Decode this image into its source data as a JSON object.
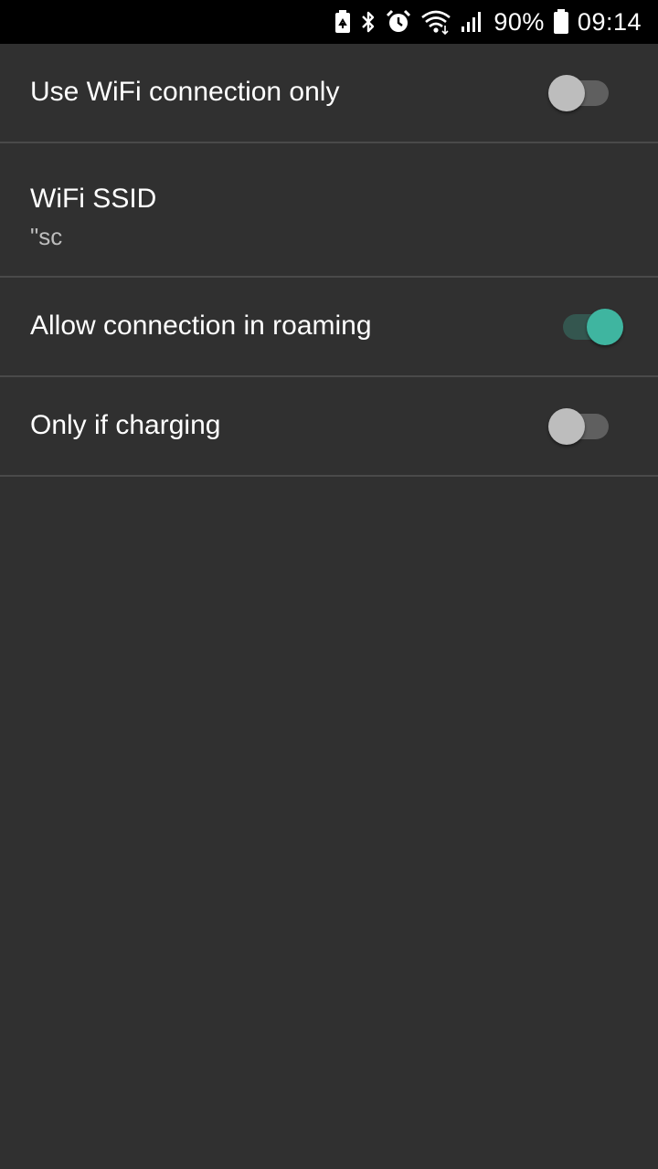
{
  "status_bar": {
    "battery_percent": "90%",
    "time": "09:14",
    "icons": [
      "battery-saver-icon",
      "bluetooth-icon",
      "alarm-icon",
      "wifi-icon",
      "signal-icon",
      "battery-icon"
    ]
  },
  "settings": [
    {
      "title": "Use WiFi connection only",
      "toggle": false
    },
    {
      "title": "WiFi SSID",
      "summary": "\"sc"
    },
    {
      "title": "Allow connection in roaming",
      "toggle": true
    },
    {
      "title": "Only if charging",
      "toggle": false
    }
  ],
  "colors": {
    "background": "#303030",
    "accent": "#3fb5a0",
    "divider": "#4a4a4a"
  }
}
